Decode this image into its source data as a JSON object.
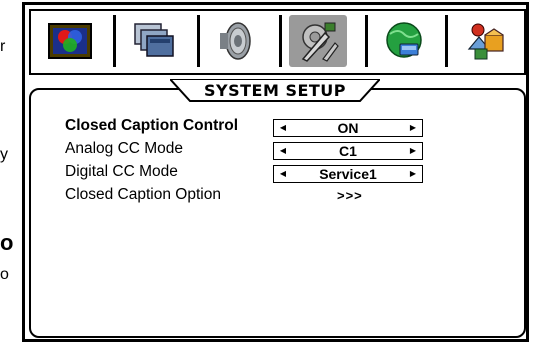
{
  "edge": {
    "r": "r",
    "y": "y",
    "o": "o",
    "o2": "o"
  },
  "tabs": [
    {
      "name": "picture",
      "icon": "picture-icon"
    },
    {
      "name": "screen",
      "icon": "screen-icon"
    },
    {
      "name": "audio",
      "icon": "speaker-icon"
    },
    {
      "name": "setup",
      "icon": "setup-tools-icon",
      "active": true
    },
    {
      "name": "network",
      "icon": "globe-icon"
    },
    {
      "name": "system",
      "icon": "system-icon"
    }
  ],
  "title": "SYSTEM SETUP",
  "items": [
    {
      "label": "Closed Caption Control",
      "value": "ON",
      "selected": true
    },
    {
      "label": "Analog CC Mode",
      "value": "C1"
    },
    {
      "label": "Digital CC Mode",
      "value": "Service1"
    },
    {
      "label": "Closed Caption Option",
      "value": ">>>"
    }
  ],
  "colors": {
    "active_tab": "#9a9a9a",
    "border": "#000000",
    "background": "#ffffff"
  }
}
